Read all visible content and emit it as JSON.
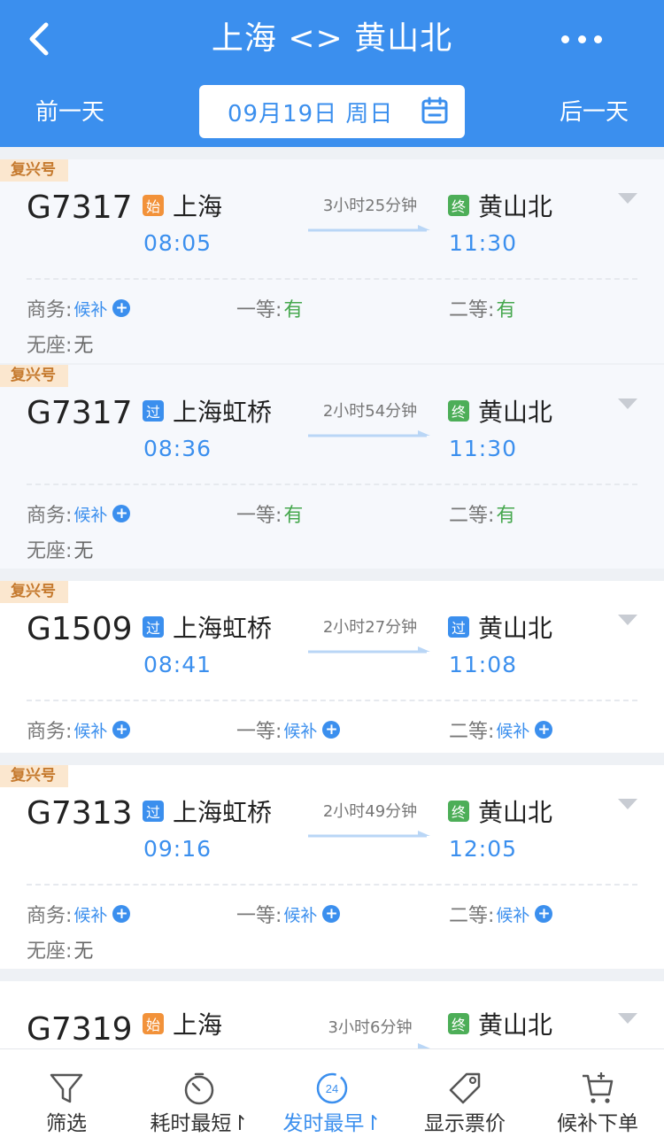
{
  "header": {
    "title": "上海 <> 黄山北",
    "prev_day": "前一天",
    "next_day": "后一天",
    "date": "09月19日 周日"
  },
  "colors": {
    "accent": "#3b8fee",
    "available": "#47a84f",
    "badge_bg": "#fbe7cf",
    "badge_text": "#c5792d"
  },
  "trains": [
    {
      "badge": "复兴号",
      "number": "G7317",
      "from_tag": "始",
      "from_tag_color": "orange",
      "from": "上海",
      "depart": "08:05",
      "duration": "3小时25分钟",
      "to_tag": "终",
      "to_tag_color": "green",
      "to": "黄山北",
      "arrive": "11:30",
      "seats": {
        "business_label": "商务:",
        "business": "候补",
        "first_label": "一等:",
        "first": "有",
        "second_label": "二等:",
        "second": "有",
        "noseat_label": "无座:",
        "noseat": "无"
      }
    },
    {
      "badge": "复兴号",
      "number": "G7317",
      "from_tag": "过",
      "from_tag_color": "blue",
      "from": "上海虹桥",
      "depart": "08:36",
      "duration": "2小时54分钟",
      "to_tag": "终",
      "to_tag_color": "green",
      "to": "黄山北",
      "arrive": "11:30",
      "seats": {
        "business_label": "商务:",
        "business": "候补",
        "first_label": "一等:",
        "first": "有",
        "second_label": "二等:",
        "second": "有",
        "noseat_label": "无座:",
        "noseat": "无"
      }
    },
    {
      "badge": "复兴号",
      "number": "G1509",
      "from_tag": "过",
      "from_tag_color": "blue",
      "from": "上海虹桥",
      "depart": "08:41",
      "duration": "2小时27分钟",
      "to_tag": "过",
      "to_tag_color": "blue",
      "to": "黄山北",
      "arrive": "11:08",
      "seats": {
        "business_label": "商务:",
        "business": "候补",
        "first_label": "一等:",
        "first": "候补",
        "second_label": "二等:",
        "second": "候补"
      }
    },
    {
      "badge": "复兴号",
      "number": "G7313",
      "from_tag": "过",
      "from_tag_color": "blue",
      "from": "上海虹桥",
      "depart": "09:16",
      "duration": "2小时49分钟",
      "to_tag": "终",
      "to_tag_color": "green",
      "to": "黄山北",
      "arrive": "12:05",
      "seats": {
        "business_label": "商务:",
        "business": "候补",
        "first_label": "一等:",
        "first": "候补",
        "second_label": "二等:",
        "second": "候补",
        "noseat_label": "无座:",
        "noseat": "无"
      }
    },
    {
      "number": "G7319",
      "from_tag": "始",
      "from_tag_color": "orange",
      "from": "上海",
      "duration": "3小时6分钟",
      "to_tag": "终",
      "to_tag_color": "green",
      "to": "黄山北"
    }
  ],
  "tabbar": [
    {
      "label": "筛选",
      "icon": "filter-icon"
    },
    {
      "label": "耗时最短↾",
      "icon": "timer-icon"
    },
    {
      "label": "发时最早↾",
      "icon": "clock-24-icon",
      "active": true,
      "icon_text": "24"
    },
    {
      "label": "显示票价",
      "icon": "price-tag-icon"
    },
    {
      "label": "候补下单",
      "icon": "cart-add-icon"
    }
  ]
}
